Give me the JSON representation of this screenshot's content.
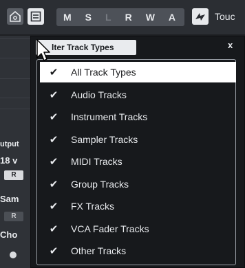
{
  "toolbar": {
    "buttons": [
      "M",
      "S",
      "L",
      "R",
      "W",
      "A"
    ],
    "touch_label": "Touc"
  },
  "left_panel": {
    "output_label": "utput",
    "value_label": "18 v",
    "r_button": "R",
    "sam_label": "Sam",
    "r_button2": "R",
    "cho_label": "Cho"
  },
  "dialog": {
    "title": "lter Track Types",
    "close": "x",
    "items": [
      {
        "label": "All Track Types",
        "checked": true,
        "selected": true
      },
      {
        "label": "Audio Tracks",
        "checked": true,
        "selected": false
      },
      {
        "label": "Instrument Tracks",
        "checked": true,
        "selected": false
      },
      {
        "label": "Sampler Tracks",
        "checked": true,
        "selected": false
      },
      {
        "label": "MIDI Tracks",
        "checked": true,
        "selected": false
      },
      {
        "label": "Group Tracks",
        "checked": true,
        "selected": false
      },
      {
        "label": "FX Tracks",
        "checked": true,
        "selected": false
      },
      {
        "label": "VCA Fader Tracks",
        "checked": true,
        "selected": false
      },
      {
        "label": "Other Tracks",
        "checked": true,
        "selected": false
      }
    ],
    "check_glyph": "✔"
  },
  "colors": {
    "selection_bg": "#ffffff",
    "dialog_bg": "#17191c",
    "toolbar_bg": "#2b2e33"
  }
}
